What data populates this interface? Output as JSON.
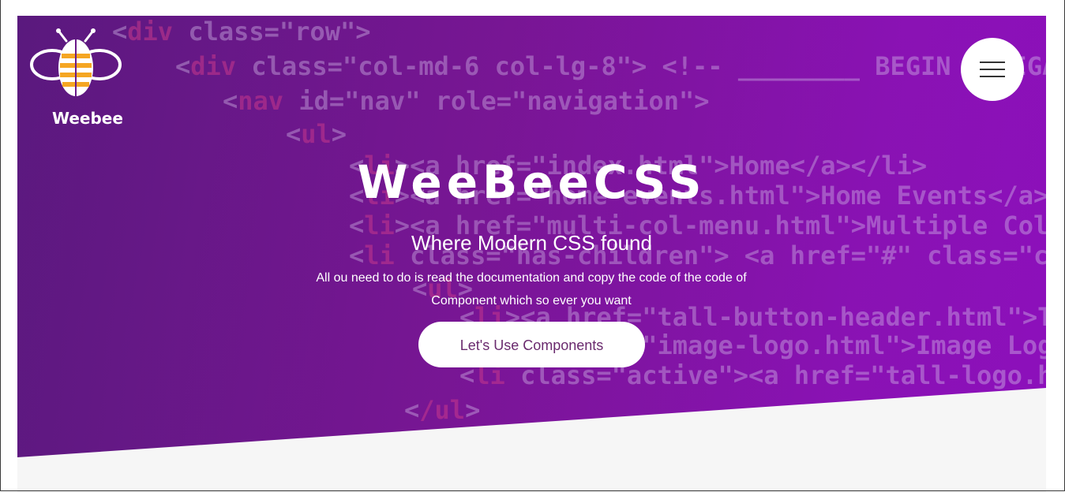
{
  "brand": {
    "logo_text": "Weebee",
    "colors": {
      "hero_start": "#5a1a7e",
      "hero_end": "#9010c0",
      "accent_yellow": "#f5a623",
      "button_text": "#6a2a6e"
    }
  },
  "header": {
    "menu_icon": "hamburger-icon"
  },
  "hero": {
    "title": "WeeBeeCSS",
    "subtitle": "Where Modern CSS found",
    "description": "All ou need to do is read the documentation and copy the code of the code of Component which so ever you want",
    "cta_label": "Let's Use Components"
  },
  "background_code": [
    {
      "tag": "div",
      "rest": " class=\"row\">"
    },
    {
      "tag": "div",
      "rest": " class=\"col-md-6 col-lg-8\"> <!-- ________ BEGIN NAVIGATION"
    },
    {
      "tag": "nav",
      "rest": " id=\"nav\" role=\"navigation\">"
    },
    {
      "tag": "ul",
      "rest": ">"
    },
    {
      "tag": "li",
      "rest": "><a href=\"index.html\">Home</a></li>"
    },
    {
      "tag": "li",
      "rest": "><a href=\"home-events.html\">Home Events</a></li>"
    },
    {
      "tag": "li",
      "rest": "><a href=\"multi-col-menu.html\">Multiple Column Menu"
    },
    {
      "tag": "li",
      "rest": " class=\"has-children\"> <a href=\"#\" class=\"current\">"
    },
    {
      "tag": "ul",
      "rest": ">"
    },
    {
      "tag": "li",
      "rest": "><a href=\"tall-button-header.html\">Tall Button"
    },
    {
      "tag": "li",
      "rest": "><a href=\"image-logo.html\">Image Logo</a></li>"
    },
    {
      "tag": "li",
      "rest": " class=\"active\"><a href=\"tall-logo.html\">Tall"
    },
    {
      "tag": "/ul",
      "rest": ">"
    }
  ]
}
